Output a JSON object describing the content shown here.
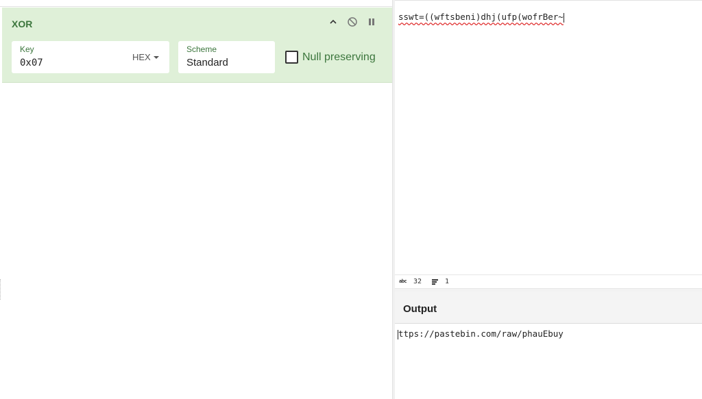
{
  "operation": {
    "title": "XOR",
    "key": {
      "label": "Key",
      "value": "0x07",
      "format": "HEX"
    },
    "scheme": {
      "label": "Scheme",
      "value": "Standard"
    },
    "null_preserving": {
      "label": "Null preserving",
      "checked": false
    }
  },
  "input": {
    "text": "sswt=((wftsbeni)dhj(ufp(wofrBer~",
    "char_count": "32",
    "line_count": "1",
    "abc_icon": "abc"
  },
  "output": {
    "title": "Output",
    "text": "ttps://pastebin.com/raw/phauEbuy"
  },
  "colors": {
    "operation_bg": "#dff0d8",
    "operation_text": "#3c763d",
    "spellcheck": "#e03030"
  }
}
